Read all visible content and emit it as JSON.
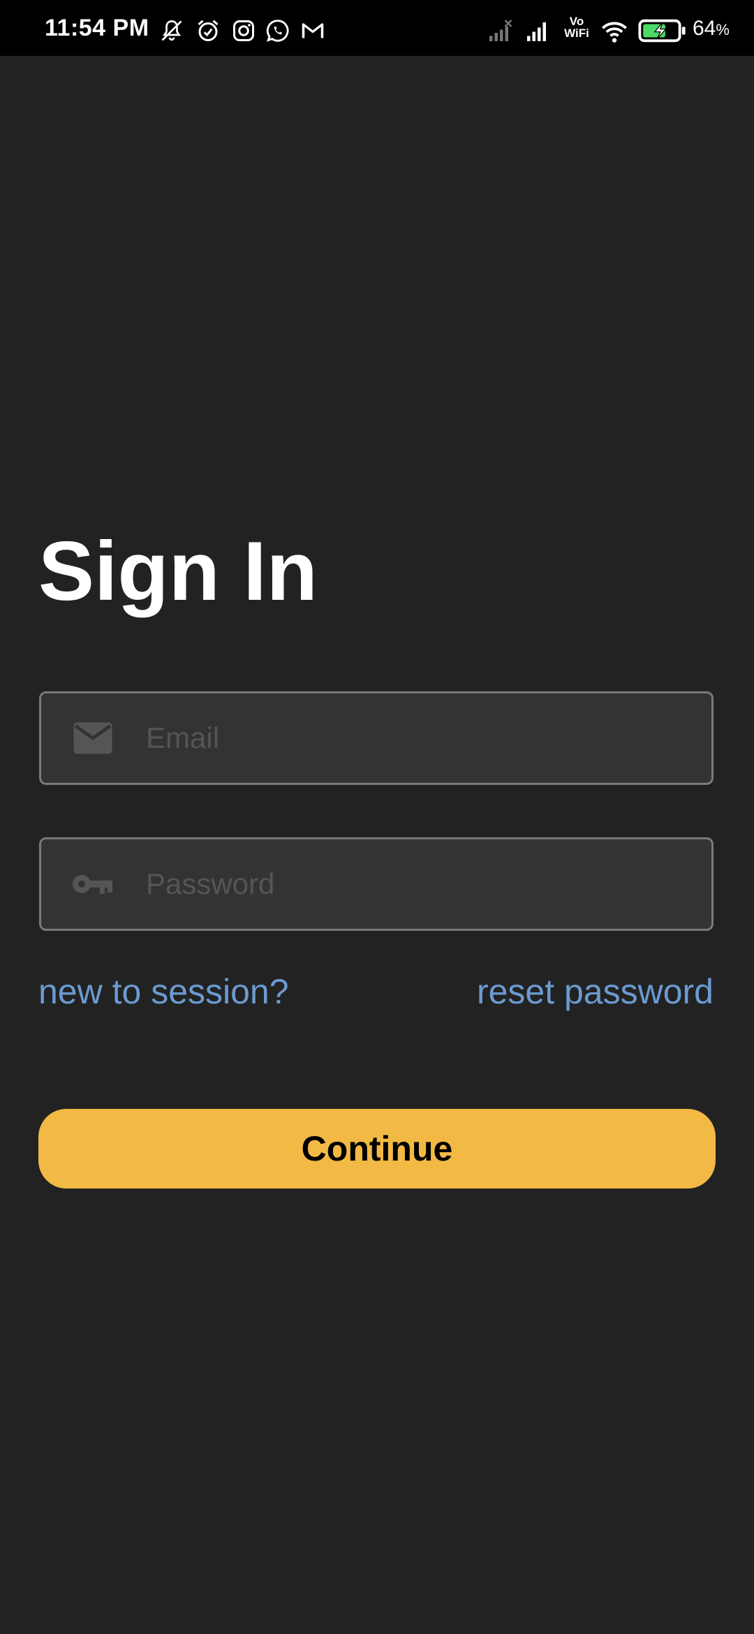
{
  "status_bar": {
    "time": "11:54 PM",
    "network_label_top": "Vo",
    "network_label_bottom": "WiFi",
    "battery_percent": "64",
    "battery_percent_sign": "%",
    "icons": [
      "mute-icon",
      "alarm-icon",
      "instagram-icon",
      "whatsapp-icon",
      "gmail-icon",
      "signal-off-icon",
      "signal-icon",
      "wifi-icon",
      "battery-charging-icon"
    ]
  },
  "signin": {
    "title": "Sign In",
    "email": {
      "value": "",
      "placeholder": "Email",
      "icon": "email-icon"
    },
    "password": {
      "value": "",
      "placeholder": "Password",
      "icon": "key-icon"
    },
    "signup_link": "new to session?",
    "reset_link": "reset password",
    "continue_label": "Continue"
  },
  "colors": {
    "background": "#222222",
    "status_bar": "#000000",
    "field_background": "#333333",
    "field_border": "#7a7a7a",
    "link": "#6b9bd1",
    "accent": "#f2b944"
  }
}
